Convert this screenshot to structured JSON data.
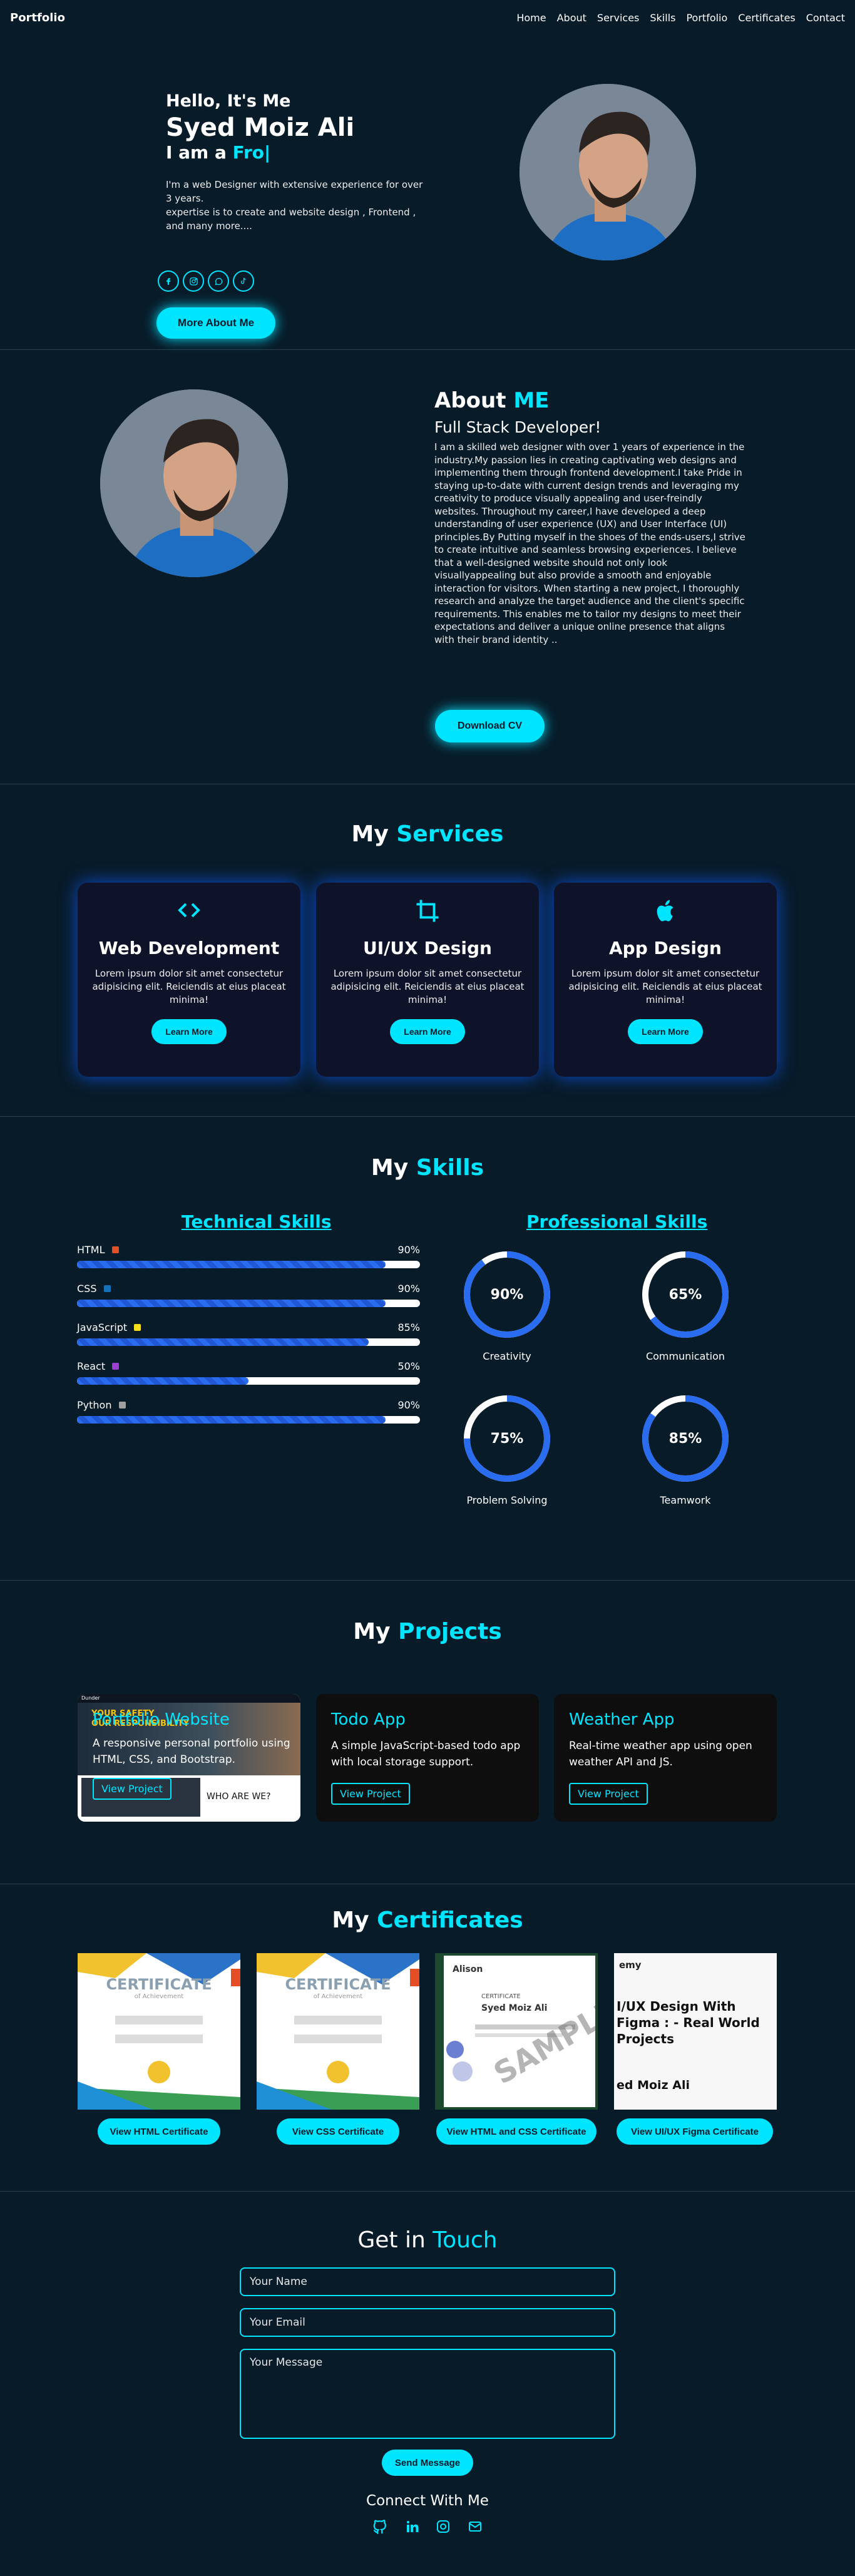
{
  "nav": {
    "logo": "Portfolio",
    "links": [
      "Home",
      "About",
      "Services",
      "Skills",
      "Portfolio",
      "Certificates",
      "Contact"
    ]
  },
  "hero": {
    "hello": "Hello, It's Me",
    "name": "Syed Moiz Ali",
    "iam_prefix": "I am a",
    "typed": "Fro|",
    "desc_1": "I'm a web Designer with extensive experience for over 3 years.",
    "desc_2": "expertise is to create and website design , Frontend , and many more....",
    "cta": "More About Me"
  },
  "about": {
    "title_plain": "About",
    "title_accent": "ME",
    "subtitle": "Full Stack Developer!",
    "paragraph": "I am a skilled web designer with over 1 years of experience in the industry.My passion lies in creating captivating web designs and implementing them through frontend development.I take Pride in staying up-to-date with current design trends and leveraging my creativity to produce visually appealing and user-freindly websites. Throughout my career,I have developed a deep understanding of user experience (UX) and User Interface (UI) principles.By Putting myself in the shoes of the ends-users,I strive to create intuitive and seamless browsing experiences. I believe that a well-designed website should not only look visuallyappealing but also provide a smooth and enjoyable interaction for visitors. When starting a new project, I thoroughly research and analyze the target audience and the client's specific requirements. This enables me to tailor my designs to meet their expectations and deliver a unique online presence that aligns with their brand identity ..",
    "cv_button": "Download CV"
  },
  "services": {
    "title_plain": "My",
    "title_accent": "Services",
    "cards": [
      {
        "icon": "code-icon",
        "title": "Web Development",
        "desc": "Lorem ipsum dolor sit amet consectetur adipisicing elit. Reiciendis at eius placeat minima!",
        "button": "Learn More"
      },
      {
        "icon": "crop-icon",
        "title": "UI/UX Design",
        "desc": "Lorem ipsum dolor sit amet consectetur adipisicing elit. Reiciendis at eius placeat minima!",
        "button": "Learn More"
      },
      {
        "icon": "apple-icon",
        "title": "App Design",
        "desc": "Lorem ipsum dolor sit amet consectetur adipisicing elit. Reiciendis at eius placeat minima!",
        "button": "Learn More"
      }
    ]
  },
  "skills": {
    "title_plain": "My",
    "title_accent": "Skills",
    "technical_heading": "Technical Skills",
    "professional_heading": "Professional Skills",
    "technical": [
      {
        "name": "HTML",
        "percent_label": "90%",
        "level": 0.9,
        "icon": "html5-icon",
        "color": "#e34f26"
      },
      {
        "name": "CSS",
        "percent_label": "90%",
        "level": 0.9,
        "icon": "css3-icon",
        "color": "#1572b6"
      },
      {
        "name": "JavaScript",
        "percent_label": "85%",
        "level": 0.85,
        "icon": "js-icon",
        "color": "#f7df1e"
      },
      {
        "name": "React",
        "percent_label": "50%",
        "level": 0.5,
        "icon": "react-icon",
        "color": "#9b3ed1"
      },
      {
        "name": "Python",
        "percent_label": "90%",
        "level": 0.9,
        "icon": "python-icon",
        "color": "#a0a0a0"
      }
    ],
    "professional": [
      {
        "name": "Creativity",
        "percent_label": "90%",
        "level": 0.9
      },
      {
        "name": "Communication",
        "percent_label": "65%",
        "level": 0.65
      },
      {
        "name": "Problem Solving",
        "percent_label": "75%",
        "level": 0.75
      },
      {
        "name": "Teamwork",
        "percent_label": "85%",
        "level": 0.85
      }
    ]
  },
  "projects": {
    "title_plain": "My",
    "title_accent": "Projects",
    "cards": [
      {
        "title": "Portfolio Website",
        "desc": "A responsive personal portfolio using HTML, CSS, and Bootstrap.",
        "button": "View Project"
      },
      {
        "title": "Todo App",
        "desc": "A simple JavaScript-based todo app with local storage support.",
        "button": "View Project"
      },
      {
        "title": "Weather App",
        "desc": "Real-time weather app using open weather API and JS.",
        "button": "View Project"
      }
    ],
    "overlay": {
      "brand": "Dunder",
      "headline_1": "YOUR SAFETY",
      "headline_2": "OUR RESPONSIBILITY",
      "who": "WHO ARE WE?"
    }
  },
  "certificates": {
    "title_plain": "My",
    "title_accent": "Certificates",
    "items": [
      {
        "button": "View HTML Certificate",
        "heading": "CERTIFICATE",
        "sub": "of Achievement"
      },
      {
        "button": "View CSS Certificate",
        "heading": "CERTIFICATE",
        "sub": "of Achievement"
      },
      {
        "button": "View HTML and CSS Certificate",
        "brand": "Alison",
        "label": "CERTIFICATE",
        "holder": "Syed Moiz Ali",
        "watermark": "SAMPLE"
      },
      {
        "button": "View UI/UX Figma Certificate",
        "brand": "emy",
        "course": "I/UX Design With Figma : - Real World Projects",
        "holder": "ed Moiz Ali"
      }
    ]
  },
  "contact": {
    "title_plain": "Get in",
    "title_accent": "Touch",
    "name_placeholder": "Your Name",
    "email_placeholder": "Your Email",
    "message_placeholder": "Your Message",
    "send": "Send Message",
    "connect": "Connect With Me",
    "icons": [
      "github-icon",
      "linkedin-icon",
      "instagram-icon",
      "mail-icon"
    ]
  },
  "colors": {
    "background": "#081b29",
    "accent": "#00e5ff",
    "card": "#0f1329",
    "bar": "#2a6cf0"
  }
}
